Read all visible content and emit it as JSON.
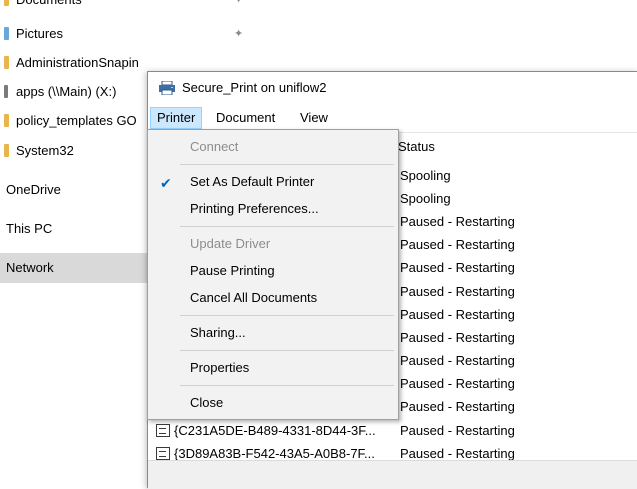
{
  "explorer": {
    "items": [
      {
        "label": "Documents",
        "type": "folder",
        "pinned": true
      },
      {
        "label": "Pictures",
        "type": "folder",
        "pinned": true
      },
      {
        "label": "AdministrationSnapin",
        "type": "folder"
      },
      {
        "label": "apps (\\\\Main) (X:)",
        "type": "drive"
      },
      {
        "label": "policy_templates GO",
        "type": "folder"
      },
      {
        "label": "System32",
        "type": "folder"
      },
      {
        "label": "OneDrive",
        "type": "top-level"
      },
      {
        "label": "This PC",
        "type": "top-level"
      },
      {
        "label": "Network",
        "type": "top-level",
        "selected": true
      }
    ]
  },
  "printer_window": {
    "title": "Secure_Print on uniflow2",
    "menus": [
      "Printer",
      "Document",
      "View"
    ],
    "active_menu": "Printer",
    "columns": {
      "status": "Status"
    },
    "status_values": [
      "Spooling",
      "Spooling",
      "Paused - Restarting",
      "Paused - Restarting",
      "Paused - Restarting",
      "Paused - Restarting",
      "Paused - Restarting",
      "Paused - Restarting",
      "Paused - Restarting",
      "Paused - Restarting",
      "Paused - Restarting",
      "Paused - Restarting",
      "Paused - Restarting"
    ],
    "visible_documents": [
      {
        "name": "{C231A5DE-B489-4331-8D44-3F...",
        "status": "Paused - Restarting"
      },
      {
        "name": "{3D89A83B-F542-43A5-A0B8-7F...",
        "status": "Paused - Restarting"
      }
    ]
  },
  "printer_menu": {
    "connect": "Connect",
    "set_default": "Set As Default Printer",
    "set_default_checked": true,
    "printing_preferences": "Printing Preferences...",
    "update_driver": "Update Driver",
    "pause_printing": "Pause Printing",
    "cancel_all": "Cancel All Documents",
    "sharing": "Sharing...",
    "properties": "Properties",
    "close": "Close"
  },
  "colors": {
    "menu_highlight": "#cce8ff",
    "check_accent": "#0067c0",
    "disabled_text": "#8d8d8d"
  }
}
